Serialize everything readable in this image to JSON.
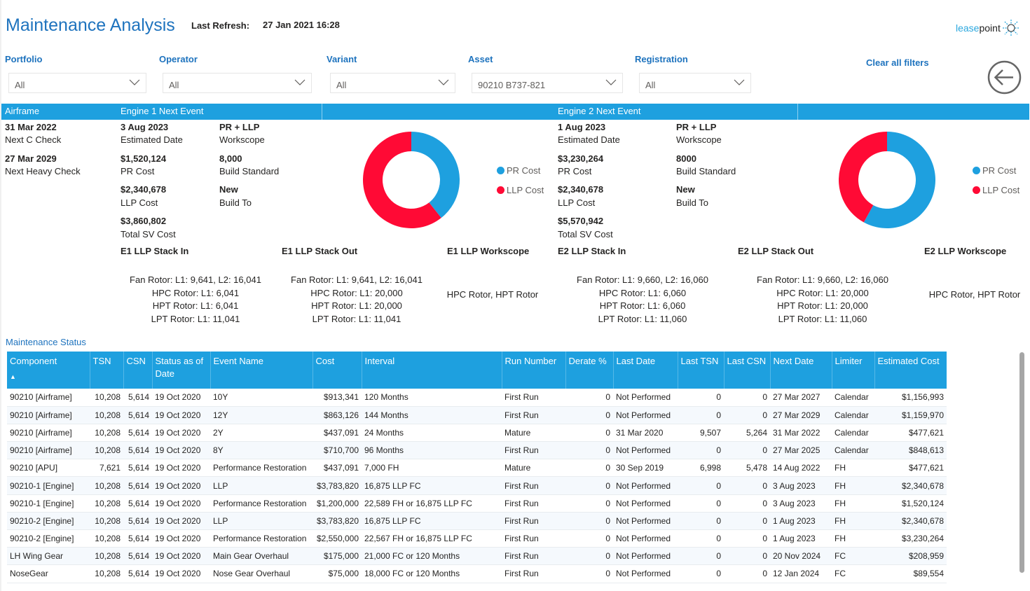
{
  "header": {
    "title": "Maintenance Analysis",
    "last_refresh_label": "Last Refresh:",
    "last_refresh_value": "27 Jan 2021 16:28",
    "logo_text_a": "lease",
    "logo_text_b": "point"
  },
  "filters": [
    {
      "label": "Portfolio",
      "value": "All"
    },
    {
      "label": "Operator",
      "value": "All"
    },
    {
      "label": "Variant",
      "value": "All"
    },
    {
      "label": "Asset",
      "value": "90210 B737-821"
    },
    {
      "label": "Registration",
      "value": "All"
    }
  ],
  "clear_filters": "Clear all filters",
  "band": {
    "airframe": "Airframe",
    "engine1": "Engine 1 Next Event",
    "engine2": "Engine 2 Next Event"
  },
  "airframe": {
    "c_date": "31 Mar 2022",
    "c_label": "Next C Check",
    "heavy_date": "27 Mar 2029",
    "heavy_label": "Next Heavy Check"
  },
  "engine1": {
    "date": "3 Aug 2023",
    "date_label": "Estimated Date",
    "workscope": "PR + LLP",
    "workscope_label": "Workscope",
    "pr_cost": "$1,520,124",
    "pr_label": "PR Cost",
    "build_standard": "8,000",
    "build_standard_label": "Build Standard",
    "llp_cost": "$2,340,678",
    "llp_label": "LLP Cost",
    "build_to": "New",
    "build_to_label": "Build To",
    "total": "$3,860,802",
    "total_label": "Total SV Cost",
    "stack_in_title": "E1 LLP Stack In",
    "stack_out_title": "E1 LLP Stack Out",
    "workscope_title": "E1 LLP Workscope",
    "stack_in": [
      "Fan Rotor: L1: 9,641, L2: 16,041",
      "HPC Rotor: L1: 6,041",
      "HPT Rotor: L1: 6,041",
      "LPT Rotor: L1: 11,041"
    ],
    "stack_out": [
      "Fan Rotor: L1: 9,641, L2: 16,041",
      "HPC Rotor: L1: 20,000",
      "HPT Rotor: L1: 20,000",
      "LPT Rotor: L1: 11,041"
    ],
    "llp_workscope": "HPC Rotor, HPT Rotor"
  },
  "engine2": {
    "date": "1 Aug 2023",
    "date_label": "Estimated Date",
    "workscope": "PR + LLP",
    "workscope_label": "Workscope",
    "pr_cost": "$3,230,264",
    "pr_label": "PR Cost",
    "build_standard": "8000",
    "build_standard_label": "Build Standard",
    "llp_cost": "$2,340,678",
    "llp_label": "LLP Cost",
    "build_to": "New",
    "build_to_label": "Build To",
    "total": "$5,570,942",
    "total_label": "Total SV Cost",
    "stack_in_title": "E2 LLP Stack In",
    "stack_out_title": "E2 LLP Stack Out",
    "workscope_title": "E2 LLP Workscope",
    "stack_in": [
      "Fan Rotor: L1: 9,660, L2: 16,060",
      "HPC Rotor: L1: 6,060",
      "HPT Rotor: L1: 6,060",
      "LPT Rotor: L1: 11,060"
    ],
    "stack_out": [
      "Fan Rotor: L1: 9,660, L2: 16,060",
      "HPC Rotor: L1: 20,000",
      "HPT Rotor: L1: 20,000",
      "LPT Rotor: L1: 11,060"
    ],
    "llp_workscope": "HPC Rotor, HPT Rotor"
  },
  "donuts": [
    {
      "legend": [
        "PR Cost",
        "LLP Cost"
      ],
      "values": [
        1520124,
        2340678
      ]
    },
    {
      "legend": [
        "PR Cost",
        "LLP Cost"
      ],
      "values": [
        3230264,
        2340678
      ]
    }
  ],
  "colors": {
    "accent": "#1ea0df",
    "pr": "#1ea0df",
    "llp": "#ff0a35",
    "title": "#1e73be"
  },
  "maintenance": {
    "title": "Maintenance Status",
    "sort_indicator": "▲",
    "columns": [
      "Component",
      "TSN",
      "CSN",
      "Status as of Date",
      "Event Name",
      "Cost",
      "Interval",
      "Run Number",
      "Derate %",
      "Last Date",
      "Last TSN",
      "Last CSN",
      "Next Date",
      "Limiter",
      "Estimated Cost"
    ],
    "rows": [
      [
        "90210 [Airframe]",
        "10,208",
        "5,614",
        "19 Oct 2020",
        "10Y",
        "$913,341",
        "120 Months",
        "First Run",
        "0",
        "Not Performed",
        "0",
        "0",
        "27 Mar 2027",
        "Calendar",
        "$1,156,993"
      ],
      [
        "90210 [Airframe]",
        "10,208",
        "5,614",
        "19 Oct 2020",
        "12Y",
        "$863,126",
        "144 Months",
        "First Run",
        "0",
        "Not Performed",
        "0",
        "0",
        "27 Mar 2029",
        "Calendar",
        "$1,159,970"
      ],
      [
        "90210 [Airframe]",
        "10,208",
        "5,614",
        "19 Oct 2020",
        "2Y",
        "$437,091",
        "24 Months",
        "Mature",
        "0",
        "31 Mar 2020",
        "9,507",
        "5,264",
        "31 Mar 2022",
        "Calendar",
        "$477,621"
      ],
      [
        "90210 [Airframe]",
        "10,208",
        "5,614",
        "19 Oct 2020",
        "8Y",
        "$710,700",
        "96 Months",
        "First Run",
        "0",
        "Not Performed",
        "0",
        "0",
        "27 Mar 2025",
        "Calendar",
        "$848,613"
      ],
      [
        "90210 [APU]",
        "7,621",
        "5,614",
        "19 Oct 2020",
        "Performance Restoration",
        "$437,091",
        "7,000 FH",
        "Mature",
        "0",
        "30 Sep 2019",
        "6,998",
        "5,478",
        "14 Aug 2022",
        "FH",
        "$477,621"
      ],
      [
        "90210-1 [Engine]",
        "10,208",
        "5,614",
        "19 Oct 2020",
        "LLP",
        "$3,783,820",
        "16,875 LLP FC",
        "First Run",
        "0",
        "Not Performed",
        "0",
        "0",
        "3 Aug 2023",
        "FH",
        "$2,340,678"
      ],
      [
        "90210-1 [Engine]",
        "10,208",
        "5,614",
        "19 Oct 2020",
        "Performance Restoration",
        "$1,200,000",
        "22,589 FH or 16,875 LLP FC",
        "First Run",
        "0",
        "Not Performed",
        "0",
        "0",
        "3 Aug 2023",
        "FH",
        "$1,520,124"
      ],
      [
        "90210-2 [Engine]",
        "10,208",
        "5,614",
        "19 Oct 2020",
        "LLP",
        "$3,783,820",
        "16,875 LLP FC",
        "First Run",
        "0",
        "Not Performed",
        "0",
        "0",
        "1 Aug 2023",
        "FH",
        "$2,340,678"
      ],
      [
        "90210-2 [Engine]",
        "10,208",
        "5,614",
        "19 Oct 2020",
        "Performance Restoration",
        "$2,550,000",
        "22,567 FH or 16,875 LLP FC",
        "First Run",
        "0",
        "Not Performed",
        "0",
        "0",
        "1 Aug 2023",
        "FH",
        "$3,230,264"
      ],
      [
        "LH Wing Gear",
        "10,208",
        "5,614",
        "19 Oct 2020",
        "Main Gear Overhaul",
        "$175,000",
        "21,000 FC or 120 Months",
        "First Run",
        "0",
        "Not Performed",
        "0",
        "0",
        "20 Nov 2024",
        "FC",
        "$208,959"
      ],
      [
        "NoseGear",
        "10,208",
        "5,614",
        "19 Oct 2020",
        "Nose Gear Overhaul",
        "$75,000",
        "18,000 FC or 120 Months",
        "First Run",
        "0",
        "Not Performed",
        "0",
        "0",
        "12 Jan 2024",
        "FC",
        "$89,554"
      ]
    ]
  }
}
